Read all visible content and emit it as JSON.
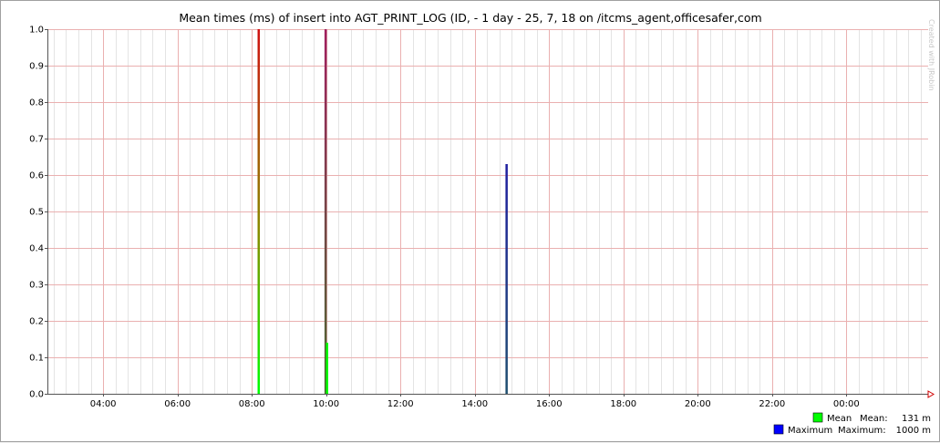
{
  "chart_data": {
    "type": "line",
    "title": "Mean times (ms) of insert into AGT_PRINT_LOG (ID, - 1 day - 25, 7, 18 on /itcms_agent,officesafer,com",
    "watermark": "Created with JRobin",
    "ylim": [
      0,
      1.0
    ],
    "y_ticks": [
      0.0,
      0.1,
      0.2,
      0.3,
      0.4,
      0.5,
      0.6,
      0.7,
      0.8,
      0.9,
      1.0
    ],
    "y_tick_labels": [
      "0.0",
      "0.1",
      "0.2",
      "0.3",
      "0.4",
      "0.5",
      "0.6",
      "0.7",
      "0.8",
      "0.9",
      "1.0"
    ],
    "xlim_hours": [
      2.5,
      26.2
    ],
    "x_ticks_hours": [
      4,
      6,
      8,
      10,
      12,
      14,
      16,
      18,
      20,
      22,
      24
    ],
    "x_tick_labels": [
      "04:00",
      "06:00",
      "08:00",
      "10:00",
      "12:00",
      "14:00",
      "16:00",
      "18:00",
      "20:00",
      "22:00",
      "00:00"
    ],
    "grid": true,
    "legend_position": "bottom-right",
    "series": [
      {
        "name": "Mean",
        "color": "#00ff00",
        "points": [
          {
            "x": 8.18,
            "y": 1.0
          },
          {
            "x": 9.98,
            "y": 1.0
          },
          {
            "x": 10.02,
            "y": 0.14
          },
          {
            "x": 14.85,
            "y": 0.63
          }
        ],
        "stat_label": "Mean:",
        "stat_value": "131 m"
      },
      {
        "name": "Maximum",
        "color": "#0000ff",
        "points": [
          {
            "x": 8.18,
            "y": 1.0
          },
          {
            "x": 9.98,
            "y": 1.0
          },
          {
            "x": 10.02,
            "y": 0.14
          },
          {
            "x": 14.85,
            "y": 0.63
          }
        ],
        "stat_label": "Maximum:",
        "stat_value": "1000 m"
      }
    ]
  }
}
